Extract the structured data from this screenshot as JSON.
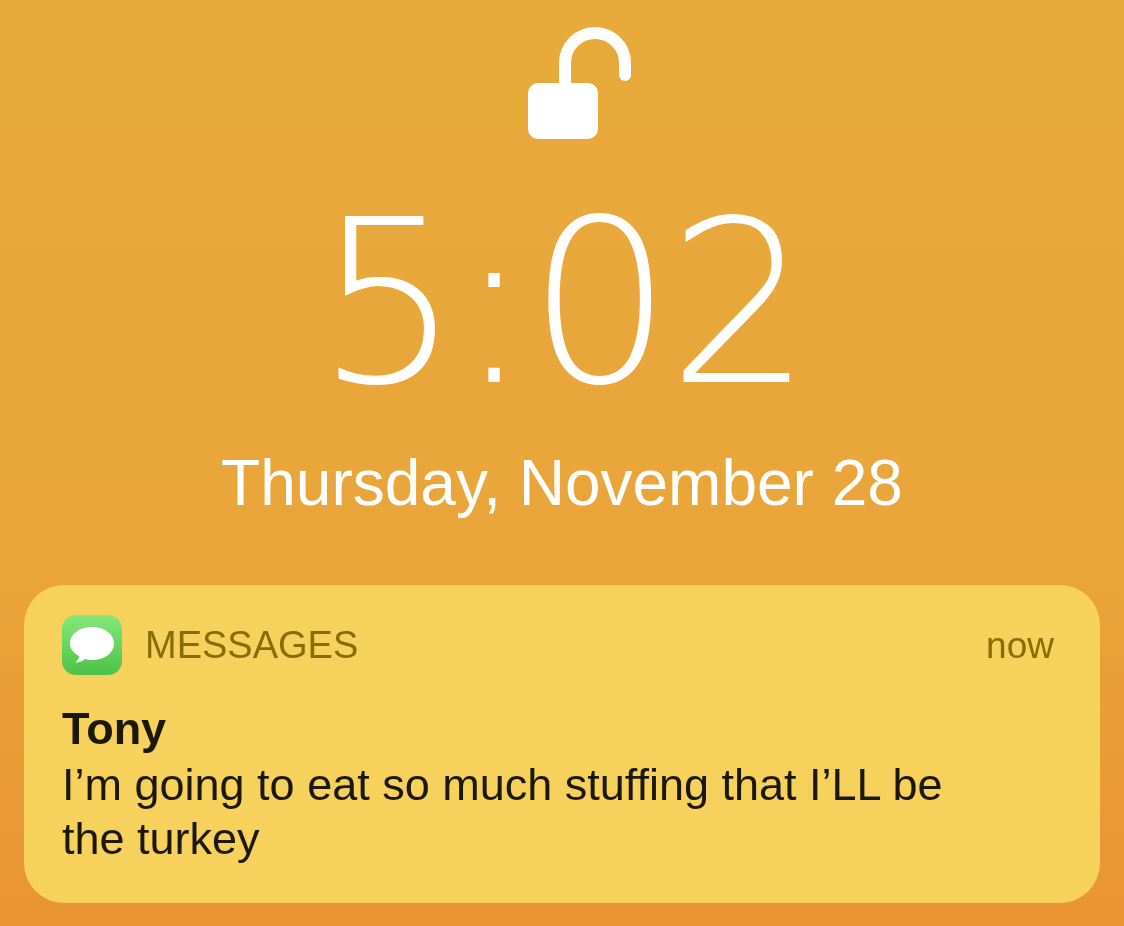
{
  "lock_screen": {
    "unlocked": true,
    "time": "5:02",
    "date": "Thursday, November 28"
  },
  "notifications": [
    {
      "app": "MESSAGES",
      "time": "now",
      "sender": "Tony",
      "message": "I’m going to eat so much stuffing that I’LL be the turkey"
    }
  ]
}
